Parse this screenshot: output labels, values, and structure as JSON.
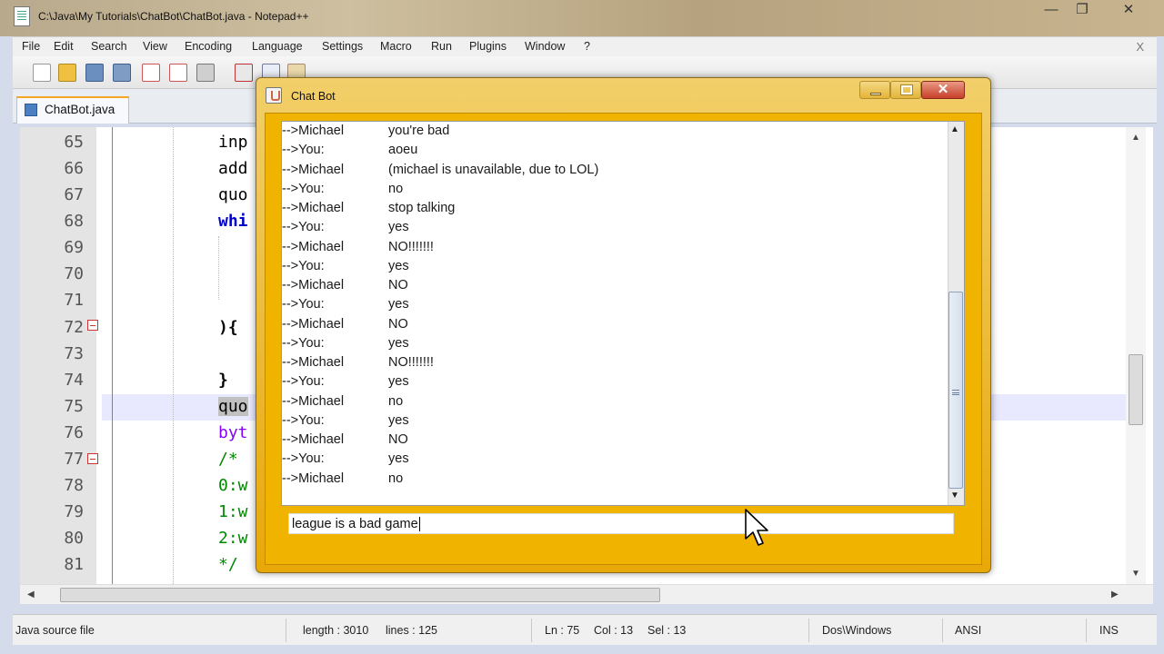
{
  "window": {
    "title": "C:\\Java\\My Tutorials\\ChatBot\\ChatBot.java - Notepad++",
    "min": "—",
    "max": "❐",
    "close": "✕"
  },
  "menu": {
    "items": [
      "File",
      "Edit",
      "Search",
      "View",
      "Encoding",
      "Language",
      "Settings",
      "Macro",
      "Run",
      "Plugins",
      "Window",
      "?"
    ],
    "close_doc": "X"
  },
  "tab": {
    "label": "ChatBot.java"
  },
  "editor": {
    "lines": [
      {
        "num": "65",
        "code": "inp",
        "color": "#000"
      },
      {
        "num": "66",
        "code": "add",
        "color": "#000"
      },
      {
        "num": "67",
        "code": "quo",
        "color": "#000"
      },
      {
        "num": "68",
        "code": "whi",
        "color": "#00c"
      },
      {
        "num": "69",
        "code": "",
        "color": "#000"
      },
      {
        "num": "70",
        "code": "",
        "color": "#000"
      },
      {
        "num": "71",
        "code": "",
        "color": "#000"
      },
      {
        "num": "72",
        "code": "){",
        "color": "#000"
      },
      {
        "num": "73",
        "code": "",
        "color": "#000"
      },
      {
        "num": "74",
        "code": "}",
        "color": "#000"
      },
      {
        "num": "75",
        "code": "quo",
        "color": "#000"
      },
      {
        "num": "76",
        "code": "byt",
        "color": "#80f"
      },
      {
        "num": "77",
        "code": "/*",
        "color": "#080"
      },
      {
        "num": "78",
        "code": "0:w",
        "color": "#080"
      },
      {
        "num": "79",
        "code": "1:w",
        "color": "#080"
      },
      {
        "num": "80",
        "code": "2:w",
        "color": "#080"
      },
      {
        "num": "81",
        "code": "*/",
        "color": "#080"
      }
    ]
  },
  "status": {
    "file_type": "Java source file",
    "length": "length : 3010",
    "lines": "lines : 125",
    "ln": "Ln : 75",
    "col": "Col : 13",
    "sel": "Sel : 13",
    "eol": "Dos\\Windows",
    "encoding": "ANSI",
    "mode": "INS"
  },
  "chatbot": {
    "title": "Chat Bot",
    "close": "✕",
    "messages": [
      {
        "sender": "-->Michael",
        "text": "you're bad"
      },
      {
        "sender": "-->You:",
        "text": "aoeu"
      },
      {
        "sender": "-->Michael",
        "text": "(michael is unavailable, due to LOL)"
      },
      {
        "sender": "-->You:",
        "text": "no"
      },
      {
        "sender": "-->Michael",
        "text": "stop talking"
      },
      {
        "sender": "-->You:",
        "text": "yes"
      },
      {
        "sender": "-->Michael",
        "text": "NO!!!!!!!"
      },
      {
        "sender": "-->You:",
        "text": "yes"
      },
      {
        "sender": "-->Michael",
        "text": "NO"
      },
      {
        "sender": "-->You:",
        "text": "yes"
      },
      {
        "sender": "-->Michael",
        "text": "NO"
      },
      {
        "sender": "-->You:",
        "text": "yes"
      },
      {
        "sender": "-->Michael",
        "text": "NO!!!!!!!"
      },
      {
        "sender": "-->You:",
        "text": "yes"
      },
      {
        "sender": "-->Michael",
        "text": "no"
      },
      {
        "sender": "-->You:",
        "text": "yes"
      },
      {
        "sender": "-->Michael",
        "text": "NO"
      },
      {
        "sender": "-->You:",
        "text": "yes"
      },
      {
        "sender": "-->Michael",
        "text": "no"
      }
    ],
    "input_value": "league is a bad game"
  }
}
